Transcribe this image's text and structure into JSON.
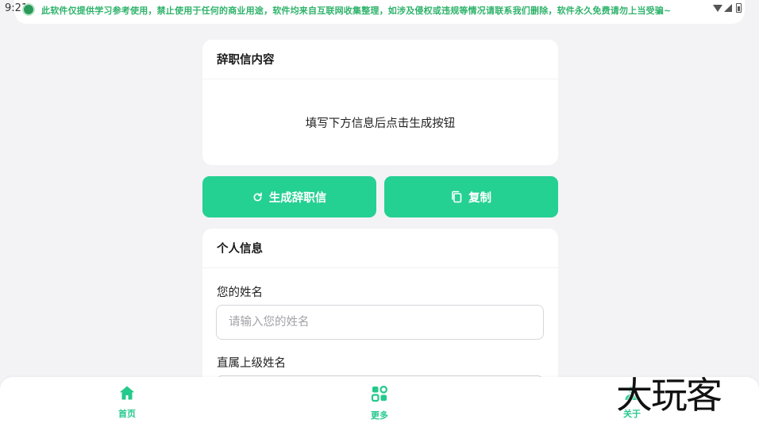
{
  "status_bar": {
    "time": "9:21",
    "notice": "此软件仅提供学习参考使用，禁止使用于任何的商业用途，软件均来自互联网收集整理，如涉及侵权或违规等情况请联系我们删除，软件永久免费请勿上当受骗~"
  },
  "letter_card": {
    "title": "辞职信内容",
    "placeholder_text": "填写下方信息后点击生成按钮"
  },
  "actions": {
    "generate_label": "生成辞职信",
    "copy_label": "复制"
  },
  "info_card": {
    "title": "个人信息",
    "fields": [
      {
        "label": "您的姓名",
        "placeholder": "请输入您的姓名",
        "value": ""
      },
      {
        "label": "直属上级姓名",
        "placeholder": "",
        "value": ""
      }
    ]
  },
  "bottom_nav": {
    "items": [
      {
        "label": "首页",
        "icon": "home-icon"
      },
      {
        "label": "更多",
        "icon": "more-icon"
      },
      {
        "label": "关于",
        "icon": "about-icon"
      }
    ]
  },
  "watermark": "大玩客",
  "colors": {
    "accent": "#25d093",
    "nav_active": "#25c98c",
    "background": "#f3f3f6",
    "notice": "#2fb36b"
  }
}
